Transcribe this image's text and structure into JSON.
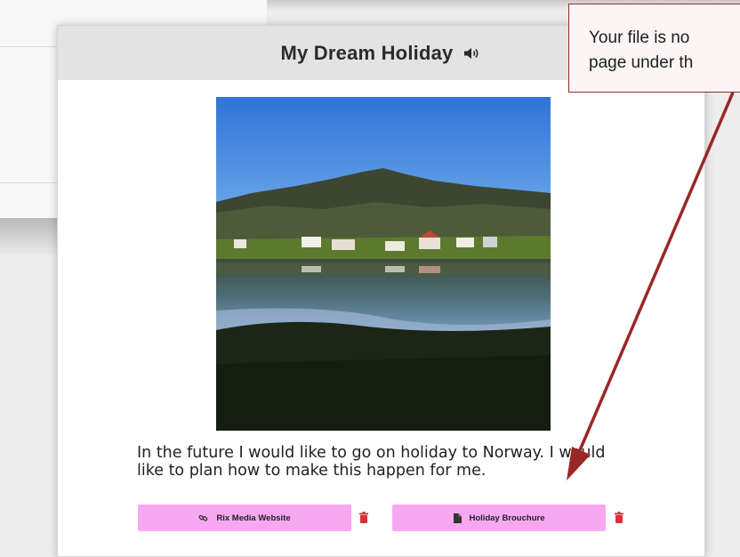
{
  "card": {
    "title": "My Dream Holiday",
    "speaker_icon": "speaker-icon",
    "description": "In the future I would like to go on holiday to Norway. I would like to plan how to make this happen for me.",
    "links": [
      {
        "label": "Rix Media Website",
        "icon": "link-icon"
      },
      {
        "label": "Holiday Brouchure",
        "icon": "document-icon"
      }
    ],
    "delete_icon": "trash-icon"
  },
  "callout": {
    "line1": "Your file is no",
    "line2": "page under th"
  },
  "colors": {
    "header_bg": "#e3e3e3",
    "button_pink": "#f7a8f1",
    "trash_red": "#d9313c",
    "arrow_dark_red": "#9a2727"
  }
}
